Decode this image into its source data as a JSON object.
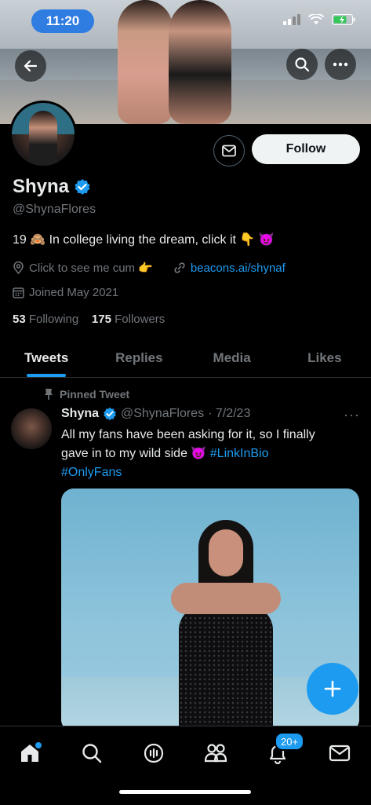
{
  "status_bar": {
    "time": "11:20"
  },
  "profile": {
    "name": "Shyna",
    "handle": "@ShynaFlores",
    "bio": "19 🙈 In college living the dream, click it 👇 😈",
    "meta_text": "Click to see me cum 👉",
    "link": "beacons.ai/shynaf",
    "joined": "Joined May 2021",
    "following_count": "53",
    "following_label": "Following",
    "followers_count": "175",
    "followers_label": "Followers",
    "follow_button": "Follow"
  },
  "tabs": [
    {
      "label": "Tweets",
      "active": true
    },
    {
      "label": "Replies"
    },
    {
      "label": "Media"
    },
    {
      "label": "Likes"
    }
  ],
  "pinned_tweet": {
    "pinned_label": "Pinned Tweet",
    "author_name": "Shyna",
    "author_handle": "@ShynaFlores",
    "date": "· 7/2/23",
    "more": "···",
    "text_line1": "All my fans have been asking for it, so I finally",
    "text_line2_a": "gave in to my wild side 😈 ",
    "text_line2_hashtag": "#LinkInBio",
    "text_line3_hashtag": "#OnlyFans"
  },
  "bottom_nav": {
    "notifications_badge": "20+"
  },
  "colors": {
    "accent": "#1d9bf0",
    "background": "#000000",
    "muted_text": "#71767b",
    "primary_text": "#e7e9ea"
  },
  "icons": [
    "back-arrow-icon",
    "search-icon",
    "more-icon",
    "mail-icon",
    "verified-icon",
    "location-icon",
    "link-icon",
    "calendar-icon",
    "pin-icon",
    "home-icon",
    "spaces-icon",
    "communities-icon",
    "bell-icon",
    "plus-icon"
  ]
}
